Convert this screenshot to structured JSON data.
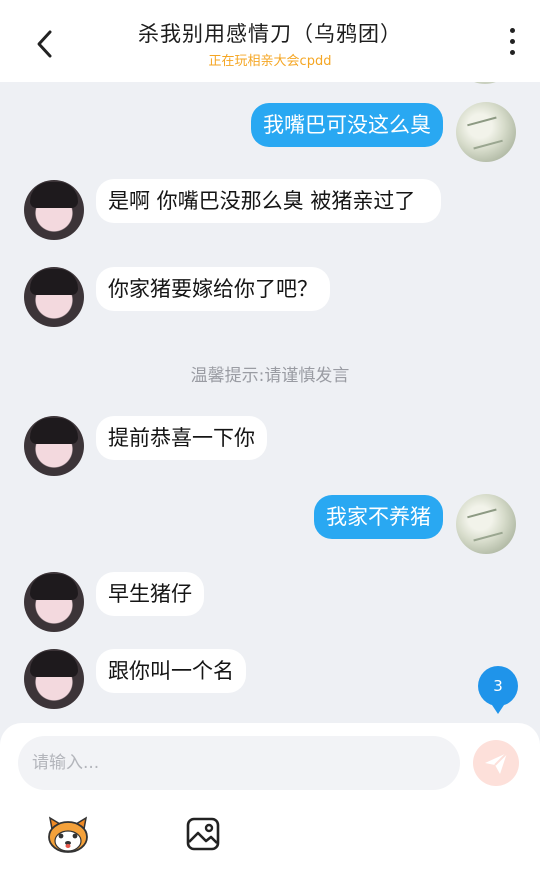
{
  "header": {
    "title": "杀我别用感情刀（乌鸦团）",
    "subtitle": "正在玩相亲大会cpdd"
  },
  "messages": [
    {
      "side": "out",
      "text": "我嘴巴可没这么臭"
    },
    {
      "side": "in",
      "text": "是啊 你嘴巴没那么臭 被猪亲过了"
    },
    {
      "side": "in",
      "text": "你家猪要嫁给你了吧？"
    },
    {
      "side": "system",
      "text": "温馨提示:请谨慎发言"
    },
    {
      "side": "in",
      "text": "提前恭喜一下你"
    },
    {
      "side": "out",
      "text": "我家不养猪"
    },
    {
      "side": "in",
      "text": "早生猪仔"
    },
    {
      "side": "in",
      "text": "跟你叫一个名"
    }
  ],
  "badge": {
    "count": "3"
  },
  "composer": {
    "placeholder": "请输入..."
  },
  "icons": {
    "back": "back-arrow-icon",
    "more": "more-vertical-icon",
    "send": "send-icon",
    "emoji": "emoji-mascot-icon",
    "image": "image-icon"
  },
  "colors": {
    "accent": "#29a8f2",
    "subtitle": "#f5a623",
    "badge": "#1f94ea",
    "send_button": "#fde0da"
  }
}
